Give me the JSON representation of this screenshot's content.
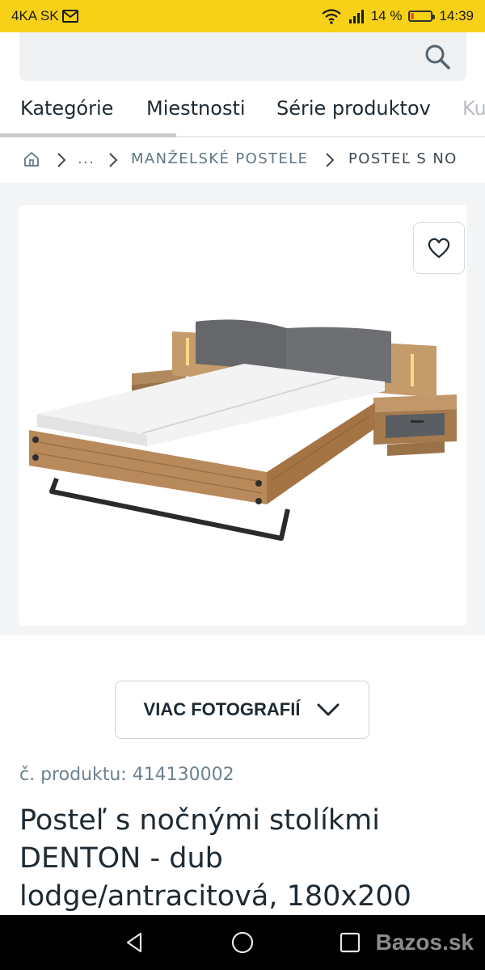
{
  "status_bar": {
    "carrier": "4KA SK",
    "battery_percent": "14 %",
    "battery_level": 0.14,
    "time": "14:39"
  },
  "search": {
    "placeholder": ""
  },
  "nav_tabs": [
    {
      "label": "Kategórie",
      "active": true
    },
    {
      "label": "Miestnosti"
    },
    {
      "label": "Série produktov"
    },
    {
      "label": "Ku"
    }
  ],
  "breadcrumb": {
    "ellipsis": "...",
    "parent": "MANŽELSKÉ POSTELE",
    "current": "POSTEĽ S NO"
  },
  "gallery": {
    "more_photos_label": "VIAC FOTOGRAFIÍ"
  },
  "product": {
    "number_label": "č. produktu: 414130002",
    "title": "Posteľ s nočnými stolíkmi DENTON - dub lodge/antracitová, 180x200"
  },
  "watermark": "Bazos.sk",
  "colors": {
    "status_bar": "#f7d117",
    "text_dark": "#1e2a33",
    "breadcrumb_text": "#5f7683"
  },
  "icons": [
    "wifi-icon",
    "signal-icon",
    "battery-icon",
    "search-icon",
    "home-icon",
    "chevron-right-icon",
    "heart-icon",
    "chevron-down-icon",
    "back-icon",
    "home-nav-icon",
    "recents-icon"
  ]
}
